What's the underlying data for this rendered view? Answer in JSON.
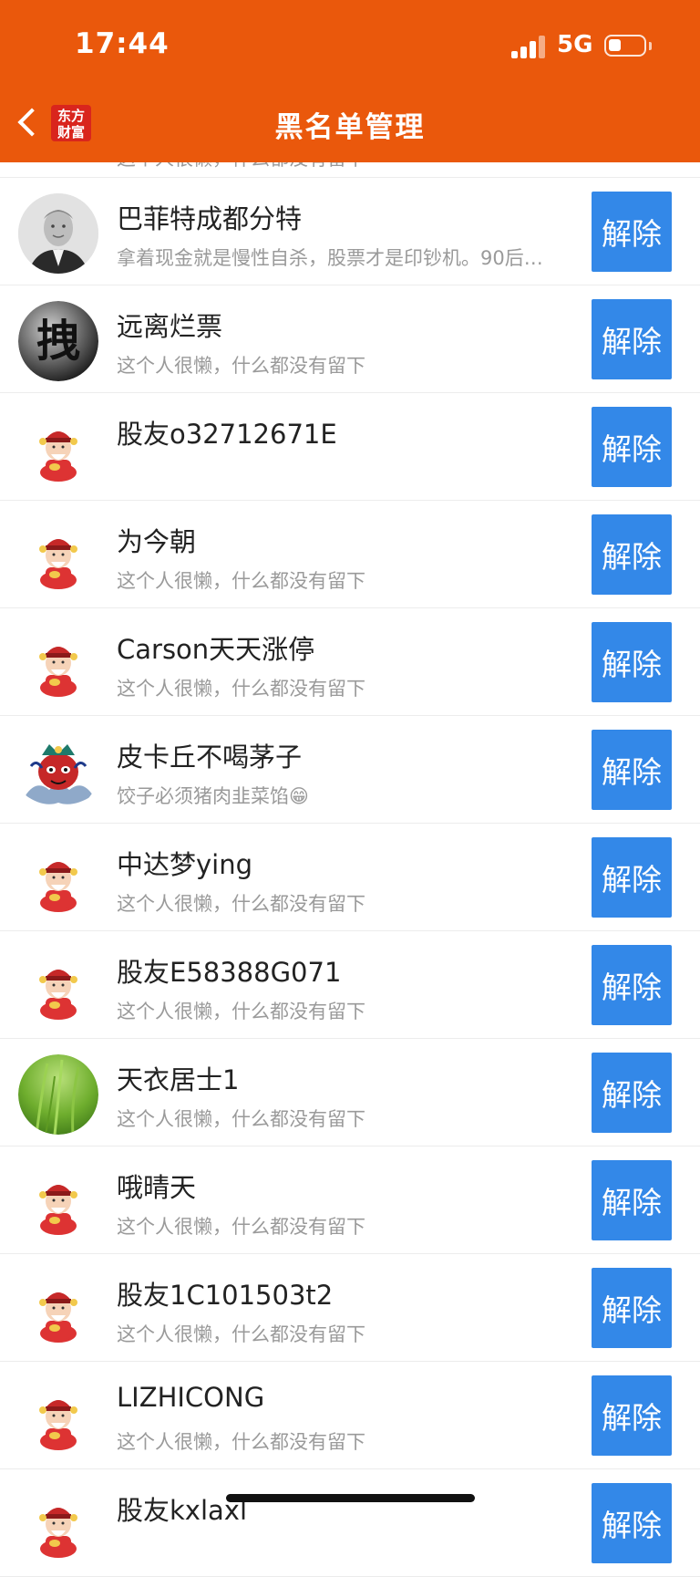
{
  "status_bar": {
    "time": "17:44",
    "network": "5G",
    "battery_level": 0.3
  },
  "header": {
    "title": "黑名单管理",
    "logo_line1": "东方",
    "logo_line2": "财富",
    "background_color": "#EA580C"
  },
  "partial_top_text": "这个人很懒，什么都没有留下",
  "unblock_label": "解除",
  "accent_color": "#3388E8",
  "rows": [
    {
      "name": "巴菲特成都分特",
      "sig": "拿着现金就是慢性自杀，股票才是印钞机。90后…",
      "avatar": "portrait-avatar"
    },
    {
      "name": "远离烂票",
      "sig": "这个人很懒，什么都没有留下",
      "avatar": "calligraphy-avatar"
    },
    {
      "name": "股友o32712671E",
      "sig": "",
      "avatar": "fortune-god-avatar"
    },
    {
      "name": "为今朝",
      "sig": "这个人很懒，什么都没有留下",
      "avatar": "fortune-god-avatar"
    },
    {
      "name": "Carson天天涨停",
      "sig": "这个人很懒，什么都没有留下",
      "avatar": "fortune-god-avatar"
    },
    {
      "name": "皮卡丘不喝茅子",
      "sig": "饺子必须猪肉韭菜馅😁",
      "avatar": "opera-mask-avatar"
    },
    {
      "name": "中达梦ying",
      "sig": "这个人很懒，什么都没有留下",
      "avatar": "fortune-god-avatar"
    },
    {
      "name": "股友E58388G071",
      "sig": "这个人很懒，什么都没有留下",
      "avatar": "fortune-god-avatar"
    },
    {
      "name": "天衣居士1",
      "sig": "这个人很懒，什么都没有留下",
      "avatar": "grass-avatar"
    },
    {
      "name": "哦晴天",
      "sig": "这个人很懒，什么都没有留下",
      "avatar": "fortune-god-avatar"
    },
    {
      "name": "股友1C101503t2",
      "sig": "这个人很懒，什么都没有留下",
      "avatar": "fortune-god-avatar"
    },
    {
      "name": "LIZHICONG",
      "sig": "这个人很懒，什么都没有留下",
      "avatar": "fortune-god-avatar"
    },
    {
      "name": "股友kxlaxl",
      "sig": "",
      "avatar": "fortune-god-avatar"
    }
  ]
}
